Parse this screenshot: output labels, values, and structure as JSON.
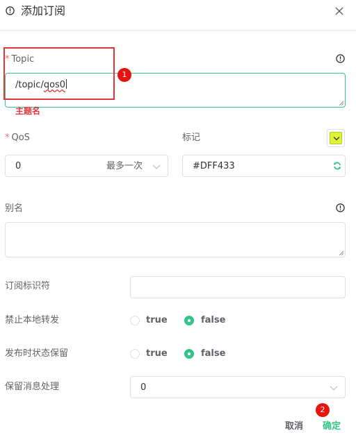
{
  "dialog": {
    "title": "添加订阅"
  },
  "form": {
    "topic": {
      "label": "Topic",
      "required": "*",
      "value_pre": "/topic/",
      "value_typo": "qos0",
      "hint": "主题名"
    },
    "qos": {
      "label": "QoS",
      "required": "*",
      "value": "0",
      "option_text": "最多一次"
    },
    "color": {
      "label": "标记",
      "value": "#DFF433",
      "swatch": "#dff433"
    },
    "alias": {
      "label": "别名",
      "value": ""
    },
    "subscription_identifier": {
      "label": "订阅标识符",
      "value": ""
    },
    "no_local": {
      "label": "禁止本地转发",
      "options": [
        "true",
        "false"
      ],
      "selected": "false"
    },
    "retain_as_published": {
      "label": "发布时状态保留",
      "options": [
        "true",
        "false"
      ],
      "selected": "false"
    },
    "retain_handling": {
      "label": "保留消息处理",
      "value": "0"
    }
  },
  "footer": {
    "cancel_label": "取消",
    "confirm_label": "确定"
  },
  "annotations": {
    "badge_1": "1",
    "badge_2": "2"
  },
  "colors": {
    "accent": "#34c388",
    "error": "#e2363a",
    "annotation": "#e8130e"
  }
}
